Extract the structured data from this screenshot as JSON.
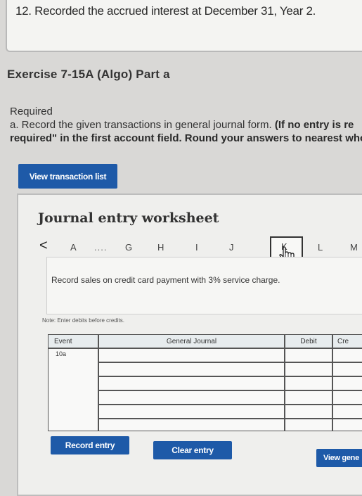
{
  "top": {
    "text": "12. Recorded the accrued interest at December 31, Year 2."
  },
  "exercise": {
    "title": "Exercise 7-15A (Algo) Part a"
  },
  "required": {
    "heading": "Required",
    "line1_normal": "a. Record the given transactions in general journal form. ",
    "line1_bold": "(If no entry is re",
    "line2_bold": "required\" in the first account field. Round your answers to nearest who"
  },
  "buttons": {
    "view_transaction_list": "View transaction list",
    "record_entry": "Record entry",
    "clear_entry": "Clear entry",
    "view_general": "View gene"
  },
  "worksheet": {
    "title": "Journal entry worksheet",
    "nav_prev": "<",
    "tabs": [
      "A",
      "....",
      "G",
      "H",
      "I",
      "J",
      "K",
      "L",
      "M"
    ],
    "active_tab": "K",
    "description": "Record sales on credit card payment with 3% service charge.",
    "note": "Note: Enter debits before credits.",
    "table": {
      "headers": {
        "event": "Event",
        "general_journal": "General Journal",
        "debit": "Debit",
        "credit": "Cre"
      },
      "event_value": "10a"
    }
  },
  "icons": [
    "hand-cursor-icon"
  ]
}
